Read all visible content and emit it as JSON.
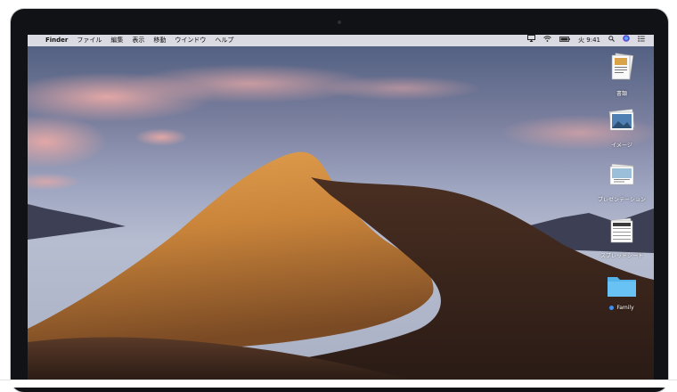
{
  "menubar": {
    "apple_icon": "apple-icon",
    "app_name": "Finder",
    "menus": [
      "ファイル",
      "編集",
      "表示",
      "移動",
      "ウインドウ",
      "ヘルプ"
    ],
    "status_icons": [
      "airplay-icon",
      "wifi-icon",
      "battery-icon"
    ],
    "clock": "火 9:41",
    "extra_icons": [
      "spotlight-icon",
      "siri-icon",
      "notification-center-icon"
    ]
  },
  "desktop": {
    "icons": [
      {
        "label": "書類",
        "icon": "documents-stack-icon"
      },
      {
        "label": "イメージ",
        "icon": "images-stack-icon"
      },
      {
        "label": "プレゼンテーション",
        "icon": "presentations-stack-icon"
      },
      {
        "label": "スプレッドシート",
        "icon": "spreadsheets-stack-icon"
      },
      {
        "label": "Family",
        "icon": "folder-icon",
        "tag_color": "#3d8ff2"
      }
    ]
  },
  "wallpaper": "Mojave sand dune"
}
